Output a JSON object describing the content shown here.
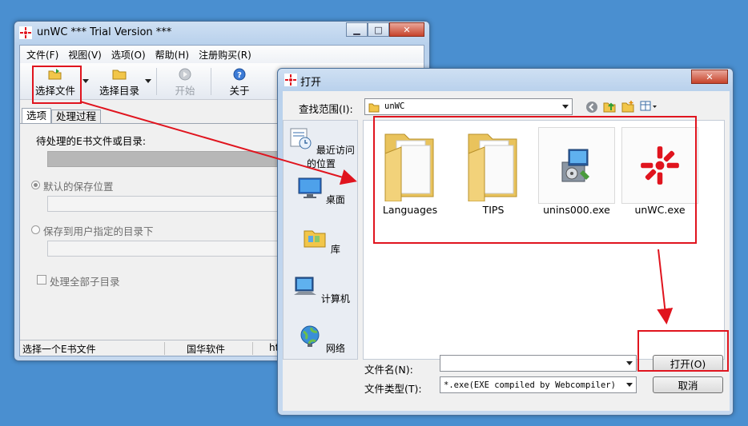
{
  "main_window": {
    "title": "unWC *** Trial Version ***",
    "caption_buttons": {
      "minimize": "▁",
      "maximize": "□",
      "close": "✕"
    },
    "menu": [
      {
        "label": "文件(F)"
      },
      {
        "label": "视图(V)"
      },
      {
        "label": "选项(O)"
      },
      {
        "label": "帮助(H)"
      },
      {
        "label": "注册购买(R)"
      }
    ],
    "toolbar": {
      "select_file": "选择文件",
      "select_dir": "选择目录",
      "start": "开始",
      "about": "关于"
    },
    "tabs": [
      {
        "label": "选项",
        "active": true
      },
      {
        "label": "处理过程",
        "active": false
      }
    ],
    "options": {
      "source_label": "待处理的E书文件或目录:",
      "source_value": "",
      "default_save_label": "默认的保存位置",
      "default_save_value": "",
      "custom_save_label": "保存到用户指定的目录下",
      "custom_save_value": "",
      "subdirs_label": "处理全部子目录"
    },
    "status": {
      "message": "选择一个E书文件",
      "company": "国华软件",
      "url": "ht"
    }
  },
  "open_dialog": {
    "title": "打开",
    "close_glyph": "✕",
    "look_in_label": "查找范围(I):",
    "look_in_value": "unWC",
    "places": [
      {
        "label": "最近访问的位置",
        "icon": "recent-places-icon"
      },
      {
        "label": "桌面",
        "icon": "desktop-icon"
      },
      {
        "label": "库",
        "icon": "library-icon"
      },
      {
        "label": "计算机",
        "icon": "computer-icon"
      },
      {
        "label": "网络",
        "icon": "network-icon"
      }
    ],
    "files": [
      {
        "name": "Languages",
        "kind": "folder"
      },
      {
        "name": "TIPS",
        "kind": "folder"
      },
      {
        "name": "unins000.exe",
        "kind": "installer"
      },
      {
        "name": "unWC.exe",
        "kind": "app"
      }
    ],
    "filename_label": "文件名(N):",
    "filename_value": "",
    "filetype_label": "文件类型(T):",
    "filetype_value": "*.exe(EXE compiled by Webcompiler)",
    "open_button": "打开(O)",
    "cancel_button": "取消"
  },
  "colors": {
    "annotation": "#e0141e",
    "desktop": "#4a8fd0"
  }
}
